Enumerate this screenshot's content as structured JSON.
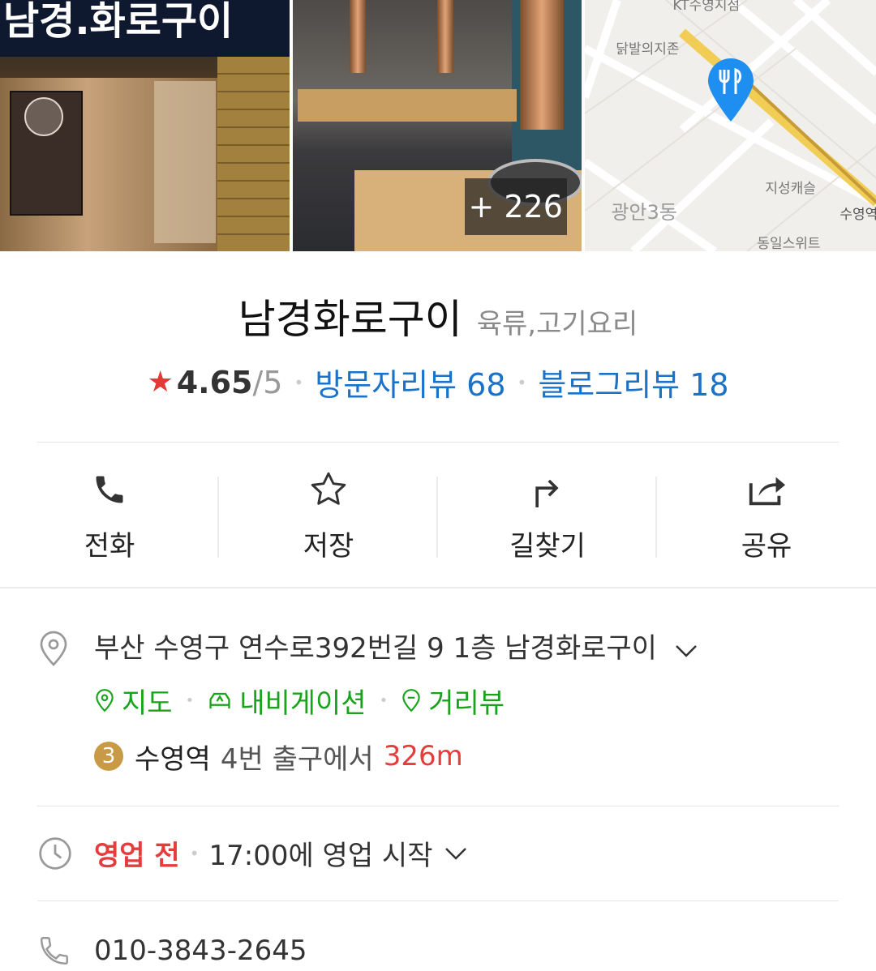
{
  "photos": {
    "sign_text": "남경.화로구이",
    "more_count": "+ 226"
  },
  "map": {
    "labels": [
      "KT수영지점",
      "닭발의지존",
      "지성캐슬",
      "광안3동",
      "수영역",
      "동일스위트"
    ],
    "station_badge": "3"
  },
  "place": {
    "name": "남경화로구이",
    "category": "육류,고기요리",
    "rating": "4.65",
    "rating_max": "/5",
    "visitor_review": "방문자리뷰 68",
    "blog_review": "블로그리뷰 18"
  },
  "actions": [
    {
      "label": "전화",
      "icon": "phone-icon"
    },
    {
      "label": "저장",
      "icon": "star-outline-icon"
    },
    {
      "label": "길찾기",
      "icon": "directions-icon"
    },
    {
      "label": "공유",
      "icon": "share-icon"
    }
  ],
  "address": {
    "text": "부산 수영구 연수로392번길 9 1층 남경화로구이",
    "links": [
      "지도",
      "내비게이션",
      "거리뷰"
    ],
    "subway_line": "3",
    "subway_station": "수영역",
    "subway_exit": "4번 출구에서",
    "subway_distance": "326m"
  },
  "hours": {
    "status": "영업 전",
    "detail": "17:00에 영업 시작"
  },
  "phone": {
    "number": "010-3843-2645"
  },
  "colors": {
    "accent_blue": "#1a73c8",
    "link_green": "#18a31a",
    "status_red": "#e53d3d",
    "star_red": "#e53935",
    "subway_badge": "#c89a45"
  }
}
